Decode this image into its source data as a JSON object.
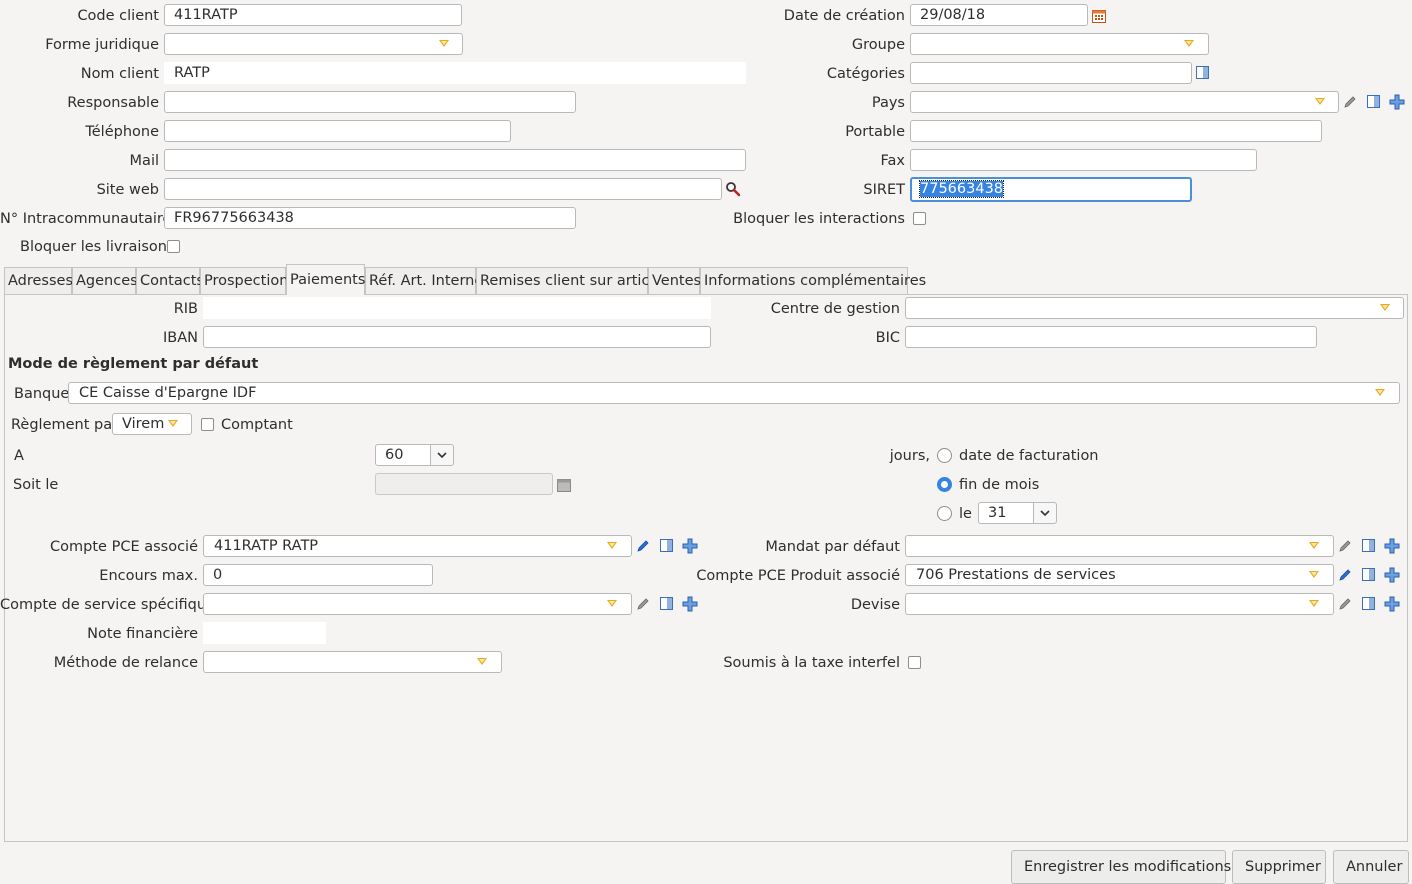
{
  "header": {
    "code_client": {
      "label": "Code client",
      "value": "411RATP"
    },
    "forme_juridique": {
      "label": "Forme juridique",
      "value": ""
    },
    "nom_client": {
      "label": "Nom client",
      "value": "RATP"
    },
    "responsable": {
      "label": "Responsable",
      "value": ""
    },
    "telephone": {
      "label": "Téléphone",
      "value": ""
    },
    "mail": {
      "label": "Mail",
      "value": ""
    },
    "site_web": {
      "label": "Site web",
      "value": ""
    },
    "intracom": {
      "label": "N° Intracommunautaire",
      "value": "FR96775663438"
    },
    "bloquer_livraisons": {
      "label": "Bloquer les livraisons",
      "checked": false
    },
    "date_creation": {
      "label": "Date de création",
      "value": "29/08/18"
    },
    "groupe": {
      "label": "Groupe",
      "value": ""
    },
    "categories": {
      "label": "Catégories",
      "value": ""
    },
    "pays": {
      "label": "Pays",
      "value": ""
    },
    "portable": {
      "label": "Portable",
      "value": ""
    },
    "fax": {
      "label": "Fax",
      "value": ""
    },
    "siret": {
      "label": "SIRET",
      "value": "775663438"
    },
    "bloquer_interactions": {
      "label": "Bloquer les interactions",
      "checked": false
    }
  },
  "tabs": [
    {
      "label": "Adresses"
    },
    {
      "label": "Agences"
    },
    {
      "label": "Contacts"
    },
    {
      "label": "Prospection"
    },
    {
      "label": "Paiements",
      "active": true
    },
    {
      "label": "Réf. Art. Interne"
    },
    {
      "label": "Remises client sur article"
    },
    {
      "label": "Ventes"
    },
    {
      "label": "Informations complémentaires"
    }
  ],
  "paiements": {
    "rib": {
      "label": "RIB",
      "value": ""
    },
    "iban": {
      "label": "IBAN",
      "value": ""
    },
    "centre_gestion": {
      "label": "Centre de gestion",
      "value": ""
    },
    "bic": {
      "label": "BIC",
      "value": ""
    },
    "section_title": "Mode de règlement par défaut",
    "banque": {
      "label": "Banque",
      "value": "CE Caisse d'Epargne IDF"
    },
    "reglement_par": {
      "label": "Règlement par",
      "value": "Virem"
    },
    "comptant": {
      "label": "Comptant",
      "checked": false
    },
    "a": {
      "label": "A",
      "value": "60"
    },
    "jours_label": "jours,",
    "soit_le": {
      "label": "Soit le",
      "value": ""
    },
    "radio_date_facturation": {
      "label": "date de facturation",
      "checked": false
    },
    "radio_fin_de_mois": {
      "label": "fin de mois",
      "checked": true
    },
    "radio_le": {
      "label": "le",
      "checked": false,
      "value": "31"
    },
    "compte_pce": {
      "label": "Compte PCE associé",
      "value": "411RATP RATP"
    },
    "encours_max": {
      "label": "Encours max.",
      "value": "0"
    },
    "compte_service": {
      "label": "Compte de service spécifique",
      "value": ""
    },
    "note_financiere": {
      "label": "Note financière",
      "value": ""
    },
    "methode_relance": {
      "label": "Méthode de relance",
      "value": ""
    },
    "mandat_defaut": {
      "label": "Mandat par défaut",
      "value": ""
    },
    "compte_pce_produit": {
      "label": "Compte PCE Produit associé",
      "value": "706 Prestations de services"
    },
    "devise": {
      "label": "Devise",
      "value": ""
    },
    "taxe_interfel": {
      "label": "Soumis à la taxe interfel",
      "checked": false
    }
  },
  "footer": {
    "save_label": "Enregistrer les modifications",
    "delete_label": "Supprimer",
    "cancel_label": "Annuler"
  },
  "colors": {
    "accent": "#3584e4",
    "arrow": "#e8a91a",
    "icon_blue": "#2a6fd6"
  },
  "icons": [
    "calendar-icon",
    "search-icon",
    "edit-icon",
    "table-icon",
    "add-icon",
    "dropdown-arrow-icon"
  ]
}
